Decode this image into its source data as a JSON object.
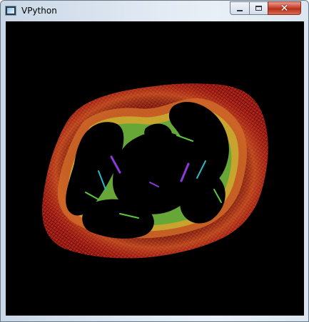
{
  "window": {
    "title": "VPython",
    "icon": "vpython-app-icon",
    "controls": {
      "minimize_icon": "minimize-icon",
      "maximize_icon": "maximize-icon",
      "close_glyph": "✕"
    }
  },
  "scene": {
    "background_color": "#000000",
    "object": "fractal-mesh",
    "colors": {
      "outer_band": "#c8281e",
      "mid_band": "#e0702a",
      "inner_yellow": "#d8c830",
      "inner_green": "#5ac83a",
      "inner_cyan": "#28b8c8",
      "inner_violet": "#8a3ad8"
    }
  }
}
